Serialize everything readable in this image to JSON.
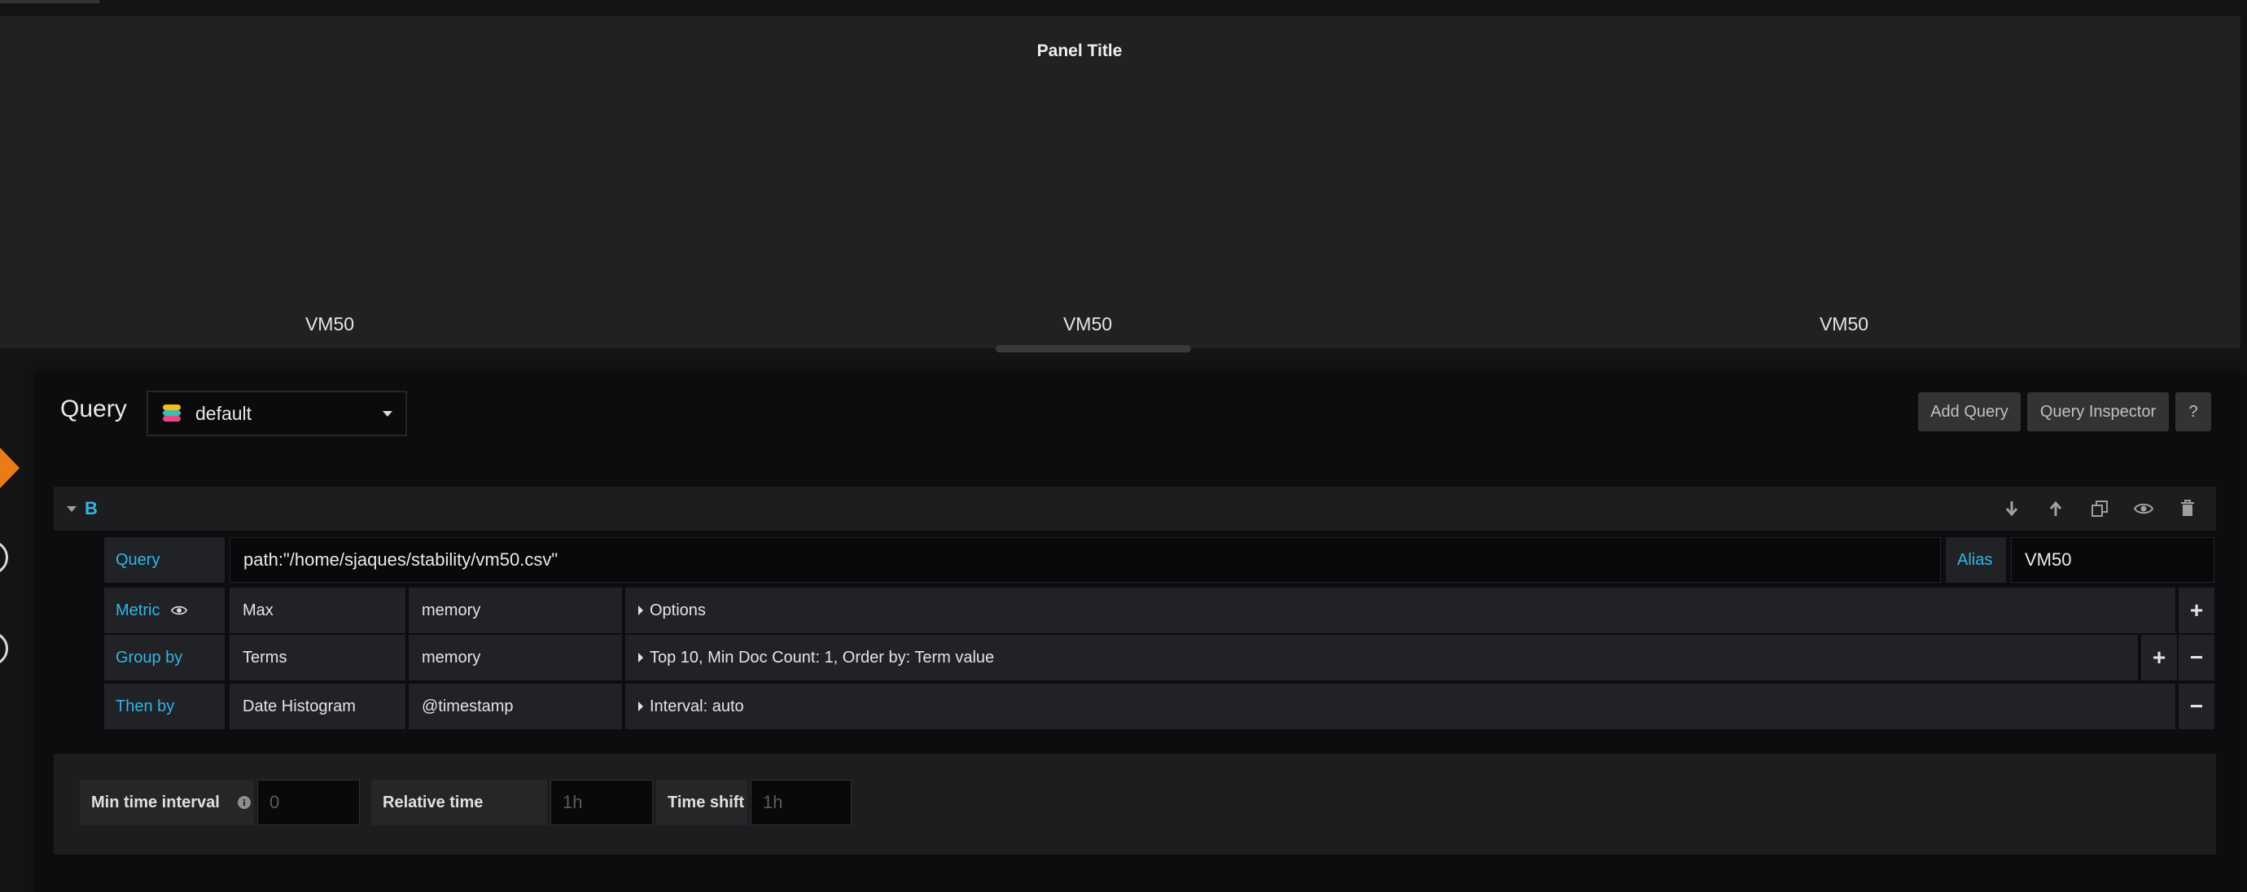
{
  "panel": {
    "title": "Panel Title",
    "labels": [
      "VM50",
      "VM50",
      "VM50"
    ]
  },
  "editor": {
    "heading": "Query",
    "datasource": "default",
    "buttons": {
      "add_query": "Add Query",
      "query_inspector": "Query Inspector",
      "help": "?"
    }
  },
  "query": {
    "ref_id": "B",
    "row_actions": [
      "move-down-icon",
      "move-up-icon",
      "duplicate-icon",
      "eye-icon",
      "trash-icon"
    ],
    "query_label": "Query",
    "query_value": "path:\"/home/sjaques/stability/vm50.csv\"",
    "alias_label": "Alias",
    "alias_value": "VM50",
    "metric": {
      "label": "Metric",
      "agg": "Max",
      "field": "memory",
      "options": "Options"
    },
    "group_by": {
      "label": "Group by",
      "agg": "Terms",
      "field": "memory",
      "options": "Top 10, Min Doc Count: 1, Order by: Term value"
    },
    "then_by": {
      "label": "Then by",
      "agg": "Date Histogram",
      "field": "@timestamp",
      "options": "Interval: auto"
    }
  },
  "options": {
    "min_interval_label": "Min time interval",
    "min_interval_placeholder": "0",
    "relative_time_label": "Relative time",
    "relative_time_placeholder": "1h",
    "time_shift_label": "Time shift",
    "time_shift_placeholder": "1h"
  },
  "colors": {
    "accent_blue": "#33b5e5",
    "accent_orange": "#eb7b18",
    "panel_bg": "#212124",
    "editor_bg": "#0d0d0f"
  }
}
